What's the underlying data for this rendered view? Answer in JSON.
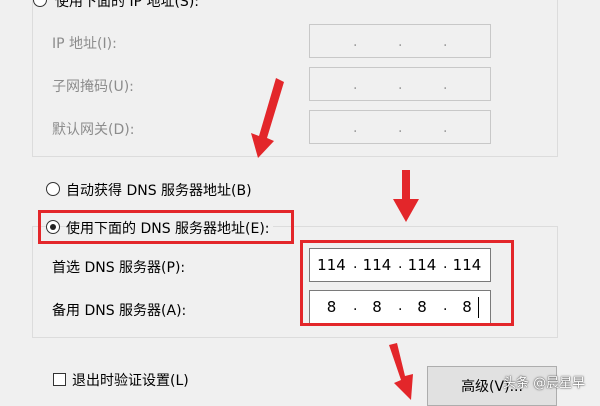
{
  "ip_section": {
    "use_following_ip_label": "使用下面的 IP 地址(S):",
    "ip_address_label": "IP 地址(I):",
    "subnet_mask_label": "子网掩码(U):",
    "default_gateway_label": "默认网关(D):",
    "dot": "."
  },
  "dns_section": {
    "auto_dns_label": "自动获得 DNS 服务器地址(B)",
    "use_following_dns_label": "使用下面的 DNS 服务器地址(E):",
    "preferred_dns_label": "首选 DNS 服务器(P):",
    "alternate_dns_label": "备用 DNS 服务器(A):",
    "preferred_dns": [
      "114",
      "114",
      "114",
      "114"
    ],
    "alternate_dns": [
      "8",
      "8",
      "8",
      "8"
    ]
  },
  "footer": {
    "validate_on_exit_label": "退出时验证设置(L)",
    "advanced_button_label": "高级(V)..."
  },
  "watermark": "头条 @晨星早",
  "colors": {
    "annotation_red": "#e3262a",
    "background": "#f0f0f0"
  }
}
